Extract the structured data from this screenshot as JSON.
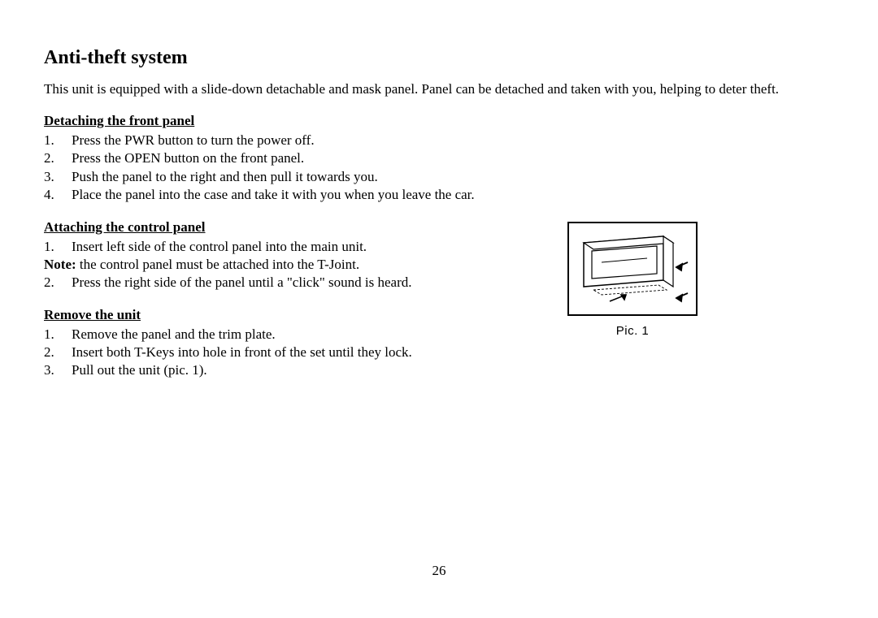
{
  "title": "Anti-theft system",
  "intro": "This unit is equipped with a slide-down detachable and mask panel. Panel can be detached and taken with you, helping to deter theft.",
  "sections": {
    "detach": {
      "heading": "Detaching the front panel",
      "steps": [
        "Press the PWR button to turn the power off.",
        "Press the OPEN button on the front panel.",
        "Push the panel to the right and then pull it towards you.",
        "Place the panel into the case and take it with you when you leave the car."
      ]
    },
    "attach": {
      "heading": "Attaching the control panel",
      "steps": [
        "Insert left side of the control panel into the main unit.",
        "Press the right side of the panel until a \"click\" sound is heard."
      ],
      "note_label": "Note:",
      "note_text": " the control panel must be attached into the T-Joint."
    },
    "remove": {
      "heading": "Remove the unit",
      "steps": [
        "Remove the panel and the trim plate.",
        "Insert both T-Keys into hole in front of the set until they lock.",
        "Pull out the unit (pic. 1)."
      ]
    }
  },
  "figure": {
    "caption": "Pic. 1"
  },
  "page_number": "26"
}
